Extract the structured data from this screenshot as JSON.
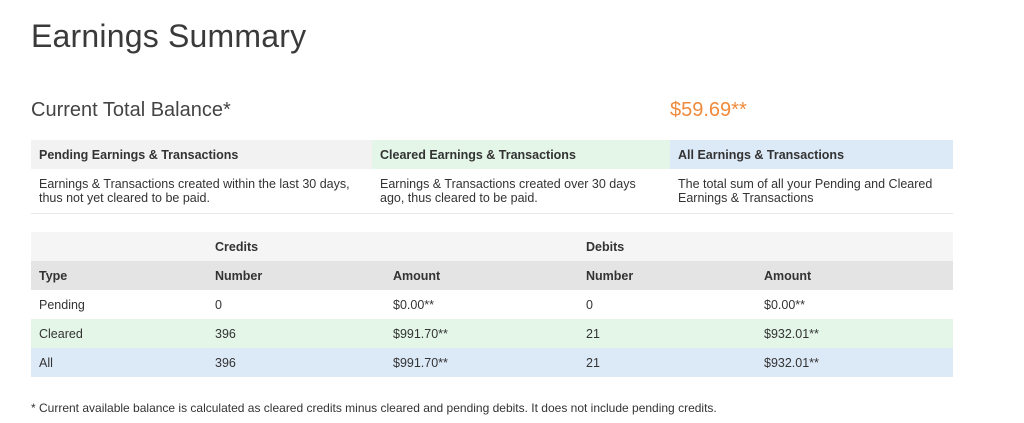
{
  "page": {
    "title": "Earnings Summary",
    "balance_label": "Current Total Balance*",
    "balance_value": "$59.69**"
  },
  "legend": {
    "headers": [
      "Pending Earnings & Transactions",
      "Cleared Earnings & Transactions",
      "All Earnings & Transactions"
    ],
    "descriptions": [
      "Earnings & Transactions created within the last 30 days, thus not yet cleared to be paid.",
      "Earnings & Transactions created over 30 days ago, thus cleared to be paid.",
      "The total sum of all your Pending and Cleared Earnings & Transactions"
    ],
    "colors": [
      "#f2f2f2",
      "#e3f6e8",
      "#dce9f7"
    ]
  },
  "stats": {
    "groups": [
      "Credits",
      "Debits"
    ],
    "columns": [
      "Type",
      "Number",
      "Amount",
      "Number",
      "Amount"
    ],
    "rows": [
      [
        "Pending",
        "0",
        "$0.00**",
        "0",
        "$0.00**"
      ],
      [
        "Cleared",
        "396",
        "$991.70**",
        "21",
        "$932.01**"
      ],
      [
        "All",
        "396",
        "$991.70**",
        "21",
        "$932.01**"
      ]
    ]
  },
  "footnote": "* Current available balance is calculated as cleared credits minus cleared and pending debits. It does not include pending credits.",
  "colors": {
    "accent": "#f08a3c"
  }
}
